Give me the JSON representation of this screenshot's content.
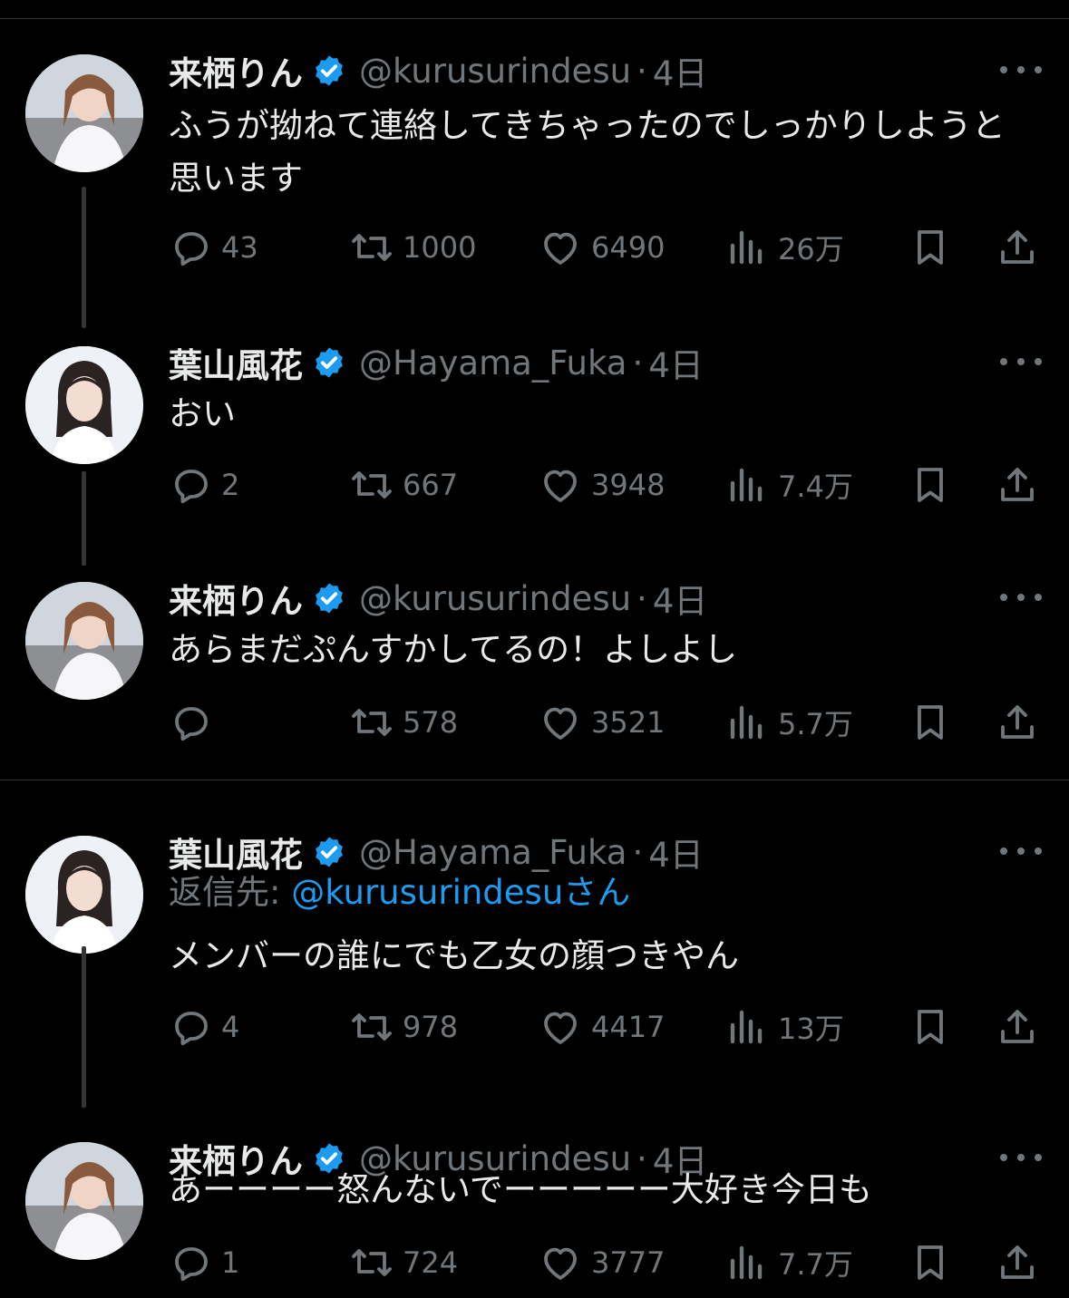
{
  "tweets": [
    {
      "name": "来栖りん",
      "handle": "@kurusurindesu",
      "dot": "·",
      "time": "4日",
      "reply_prefix": "",
      "reply_handle": "",
      "reply_suffix": "",
      "text": "ふうが拗ねて連絡してきちゃったのでしっかりしようと思います",
      "replies": "43",
      "retweets": "1000",
      "likes": "6490",
      "views": "26万",
      "avatar": "avatar-rin"
    },
    {
      "name": "葉山風花",
      "handle": "@Hayama_Fuka",
      "dot": "·",
      "time": "4日",
      "reply_prefix": "",
      "reply_handle": "",
      "reply_suffix": "",
      "text": "おい",
      "replies": "2",
      "retweets": "667",
      "likes": "3948",
      "views": "7.4万",
      "avatar": "avatar-fuka"
    },
    {
      "name": "来栖りん",
      "handle": "@kurusurindesu",
      "dot": "·",
      "time": "4日",
      "reply_prefix": "",
      "reply_handle": "",
      "reply_suffix": "",
      "text": "あらまだぷんすかしてるの！よしよし",
      "replies": "",
      "retweets": "578",
      "likes": "3521",
      "views": "5.7万",
      "avatar": "avatar-rin"
    },
    {
      "name": "葉山風花",
      "handle": "@Hayama_Fuka",
      "dot": "·",
      "time": "4日",
      "reply_prefix": "返信先: ",
      "reply_handle": "@kurusurindesu",
      "reply_suffix": "さん",
      "text": "メンバーの誰にでも乙女の顔つきやん",
      "replies": "4",
      "retweets": "978",
      "likes": "4417",
      "views": "13万",
      "avatar": "avatar-fuka"
    },
    {
      "name": "来栖りん",
      "handle": "@kurusurindesu",
      "dot": "·",
      "time": "4日",
      "reply_prefix": "",
      "reply_handle": "",
      "reply_suffix": "",
      "text": "あーーーー怒んないでーーーーー大好き今日も",
      "replies": "1",
      "retweets": "724",
      "likes": "3777",
      "views": "7.7万",
      "avatar": "avatar-rin"
    }
  ],
  "icons": {
    "verified": "verified-badge-icon",
    "more": "more-options-icon",
    "reply": "reply-icon",
    "retweet": "retweet-icon",
    "like": "like-icon",
    "views": "views-icon",
    "bookmark": "bookmark-icon",
    "share": "share-icon"
  },
  "colors": {
    "background": "#000000",
    "text": "#e7e9ea",
    "secondary": "#71767b",
    "verified": "#1d9bf0",
    "mention": "#1d9bf0",
    "separator": "#2f3336"
  }
}
